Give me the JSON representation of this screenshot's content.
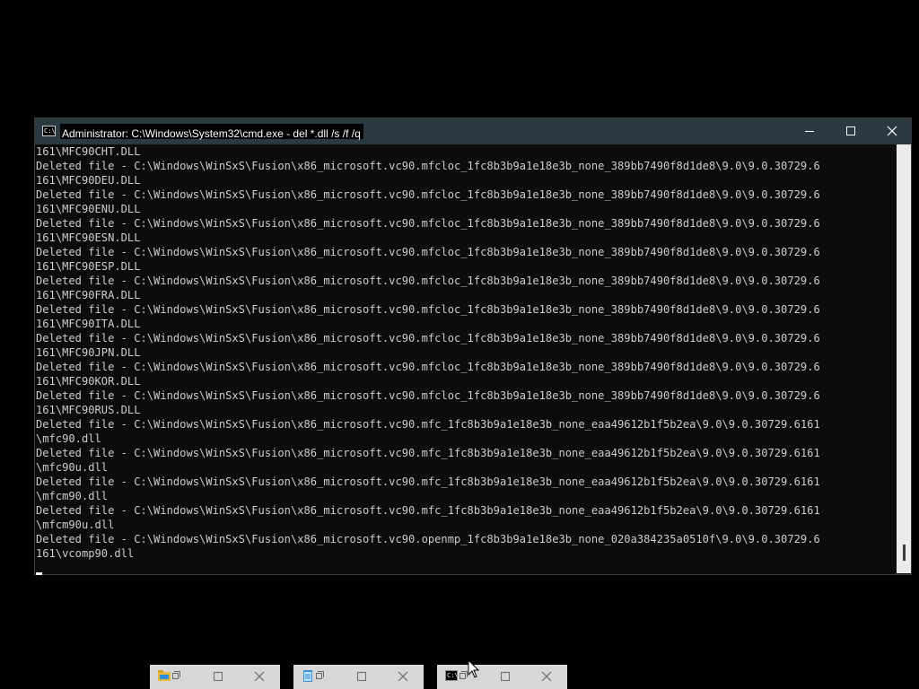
{
  "window": {
    "title": "Administrator: C:\\Windows\\System32\\cmd.exe - del  *.dll /s /f /q",
    "icon": "cmd-icon",
    "icon_text": "C:\\",
    "buttons": {
      "minimize": "minimize-icon",
      "maximize": "maximize-icon",
      "close": "close-icon"
    }
  },
  "console": {
    "lines": [
      "161\\MFC90CHT.DLL",
      "Deleted file - C:\\Windows\\WinSxS\\Fusion\\x86_microsoft.vc90.mfcloc_1fc8b3b9a1e18e3b_none_389bb7490f8d1de8\\9.0\\9.0.30729.6",
      "161\\MFC90DEU.DLL",
      "Deleted file - C:\\Windows\\WinSxS\\Fusion\\x86_microsoft.vc90.mfcloc_1fc8b3b9a1e18e3b_none_389bb7490f8d1de8\\9.0\\9.0.30729.6",
      "161\\MFC90ENU.DLL",
      "Deleted file - C:\\Windows\\WinSxS\\Fusion\\x86_microsoft.vc90.mfcloc_1fc8b3b9a1e18e3b_none_389bb7490f8d1de8\\9.0\\9.0.30729.6",
      "161\\MFC90ESN.DLL",
      "Deleted file - C:\\Windows\\WinSxS\\Fusion\\x86_microsoft.vc90.mfcloc_1fc8b3b9a1e18e3b_none_389bb7490f8d1de8\\9.0\\9.0.30729.6",
      "161\\MFC90ESP.DLL",
      "Deleted file - C:\\Windows\\WinSxS\\Fusion\\x86_microsoft.vc90.mfcloc_1fc8b3b9a1e18e3b_none_389bb7490f8d1de8\\9.0\\9.0.30729.6",
      "161\\MFC90FRA.DLL",
      "Deleted file - C:\\Windows\\WinSxS\\Fusion\\x86_microsoft.vc90.mfcloc_1fc8b3b9a1e18e3b_none_389bb7490f8d1de8\\9.0\\9.0.30729.6",
      "161\\MFC90ITA.DLL",
      "Deleted file - C:\\Windows\\WinSxS\\Fusion\\x86_microsoft.vc90.mfcloc_1fc8b3b9a1e18e3b_none_389bb7490f8d1de8\\9.0\\9.0.30729.6",
      "161\\MFC90JPN.DLL",
      "Deleted file - C:\\Windows\\WinSxS\\Fusion\\x86_microsoft.vc90.mfcloc_1fc8b3b9a1e18e3b_none_389bb7490f8d1de8\\9.0\\9.0.30729.6",
      "161\\MFC90KOR.DLL",
      "Deleted file - C:\\Windows\\WinSxS\\Fusion\\x86_microsoft.vc90.mfcloc_1fc8b3b9a1e18e3b_none_389bb7490f8d1de8\\9.0\\9.0.30729.6",
      "161\\MFC90RUS.DLL",
      "Deleted file - C:\\Windows\\WinSxS\\Fusion\\x86_microsoft.vc90.mfc_1fc8b3b9a1e18e3b_none_eaa49612b1f5b2ea\\9.0\\9.0.30729.6161",
      "\\mfc90.dll",
      "Deleted file - C:\\Windows\\WinSxS\\Fusion\\x86_microsoft.vc90.mfc_1fc8b3b9a1e18e3b_none_eaa49612b1f5b2ea\\9.0\\9.0.30729.6161",
      "\\mfc90u.dll",
      "Deleted file - C:\\Windows\\WinSxS\\Fusion\\x86_microsoft.vc90.mfc_1fc8b3b9a1e18e3b_none_eaa49612b1f5b2ea\\9.0\\9.0.30729.6161",
      "\\mfcm90.dll",
      "Deleted file - C:\\Windows\\WinSxS\\Fusion\\x86_microsoft.vc90.mfc_1fc8b3b9a1e18e3b_none_eaa49612b1f5b2ea\\9.0\\9.0.30729.6161",
      "\\mfcm90u.dll",
      "Deleted file - C:\\Windows\\WinSxS\\Fusion\\x86_microsoft.vc90.openmp_1fc8b3b9a1e18e3b_none_020a384235a0510f\\9.0\\9.0.30729.6",
      "161\\vcomp90.dll"
    ]
  },
  "taskbar_thumbnails": [
    {
      "icon": "file-explorer-icon",
      "restore_icon": "restore-icon",
      "maximize_icon": "maximize-icon",
      "close_icon": "close-icon"
    },
    {
      "icon": "notepad-icon",
      "restore_icon": "restore-icon",
      "maximize_icon": "maximize-icon",
      "close_icon": "close-icon"
    },
    {
      "icon": "cmd-icon",
      "icon_text": "C:\\",
      "restore_icon": "restore-icon",
      "maximize_icon": "maximize-icon",
      "close_icon": "close-icon"
    }
  ],
  "colors": {
    "desktop": "#000000",
    "titlebar": "#2b3a42",
    "console_bg": "#0c0c0c",
    "console_text": "#cccccc",
    "scrollbar": "#ebebeb",
    "thumbnail_bar": "#d7d7d7"
  }
}
